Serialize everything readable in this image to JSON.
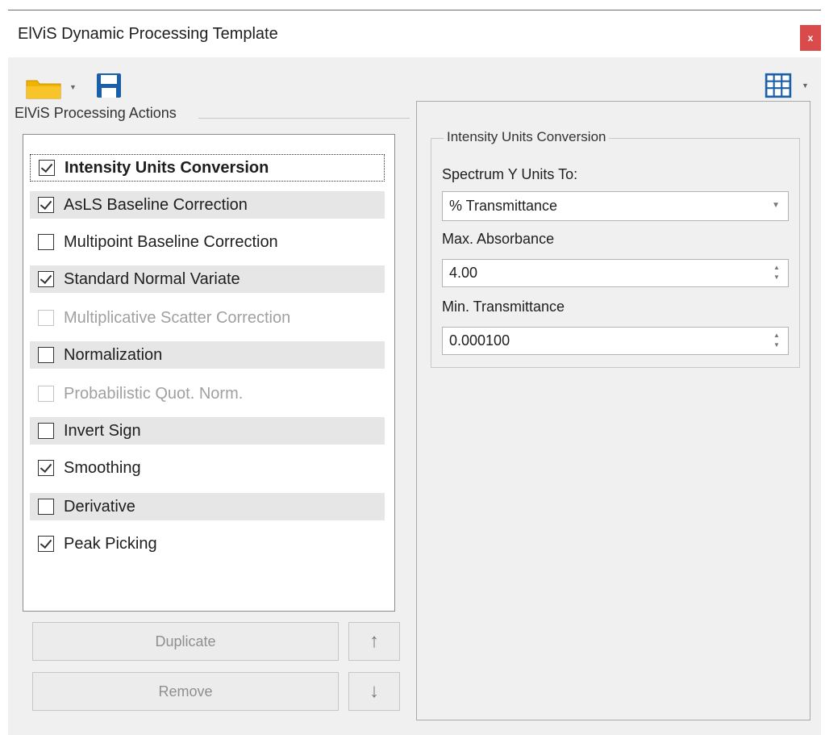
{
  "window": {
    "title": "ElViS Dynamic Processing Template",
    "close_label": "x"
  },
  "toolbar": {
    "open_icon": "folder-icon",
    "save_icon": "save-icon",
    "view_icon": "grid-icon"
  },
  "actions_group": {
    "label": "ElViS Processing Actions",
    "items": [
      {
        "label": "Intensity Units Conversion",
        "checked": true,
        "enabled": true,
        "selected": true
      },
      {
        "label": "AsLS Baseline Correction",
        "checked": true,
        "enabled": true
      },
      {
        "label": "Multipoint Baseline Correction",
        "checked": false,
        "enabled": true
      },
      {
        "label": "Standard Normal Variate",
        "checked": true,
        "enabled": true
      },
      {
        "label": "Multiplicative Scatter Correction",
        "checked": false,
        "enabled": false
      },
      {
        "label": "Normalization",
        "checked": false,
        "enabled": true
      },
      {
        "label": "Probabilistic Quot. Norm.",
        "checked": false,
        "enabled": false
      },
      {
        "label": "Invert Sign",
        "checked": false,
        "enabled": true
      },
      {
        "label": "Smoothing",
        "checked": true,
        "enabled": true
      },
      {
        "label": "Derivative",
        "checked": false,
        "enabled": true
      },
      {
        "label": "Peak Picking",
        "checked": true,
        "enabled": true
      }
    ],
    "duplicate_label": "Duplicate",
    "remove_label": "Remove",
    "move_up_label": "↑",
    "move_down_label": "↓"
  },
  "settings": {
    "group_label": "Intensity Units Conversion",
    "y_units_label": "Spectrum Y Units To:",
    "y_units_value": "% Transmittance",
    "max_abs_label": "Max. Absorbance",
    "max_abs_value": "4.00",
    "min_trans_label": "Min. Transmittance",
    "min_trans_value": "0.000100"
  },
  "colors": {
    "close_button": "#d94a4a",
    "folder": "#f0b400",
    "save_icon": "#1b5fa8",
    "grid_icon": "#1b5fa8"
  }
}
